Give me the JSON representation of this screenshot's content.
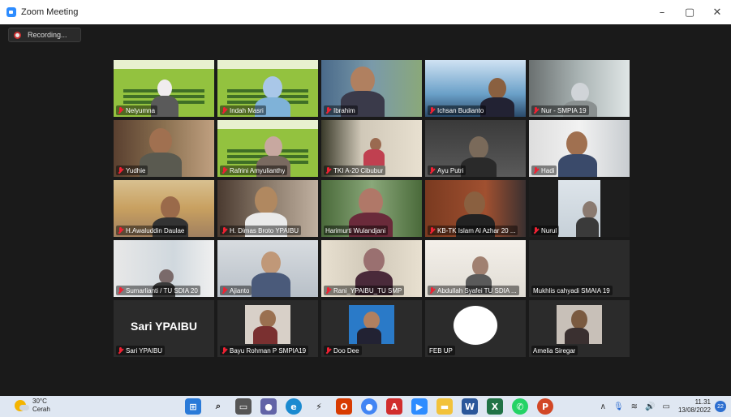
{
  "window": {
    "title": "Zoom Meeting",
    "minimize": "–",
    "restore": "▢",
    "close": "✕"
  },
  "recording": {
    "label": "Recording..."
  },
  "participants": [
    {
      "name": "Nelyumna"
    },
    {
      "name": "Indah Masri"
    },
    {
      "name": "Ibrahim"
    },
    {
      "name": "Ichsan Budianto"
    },
    {
      "name": "Nur - SMPIA 19"
    },
    {
      "name": "Yudhie"
    },
    {
      "name": "Rafrini Amyulianthy"
    },
    {
      "name": "TKI A-20 Cibubur"
    },
    {
      "name": "Ayu Putri"
    },
    {
      "name": "Hadi"
    },
    {
      "name": "H.Awaluddin Daulae"
    },
    {
      "name": "H. Dimas Broto YPAIBU"
    },
    {
      "name": "Harimurti Wulandjani"
    },
    {
      "name": "KB-TK Islam Al Azhar 20 ..."
    },
    {
      "name": "Nurul"
    },
    {
      "name": "Sumarlianti / TU SDIA 20"
    },
    {
      "name": "Ajianto"
    },
    {
      "name": "Rani_YPAIBU_TU SMP"
    },
    {
      "name": "Abdullah Syafei TU SDIA ..."
    },
    {
      "name": "Mukhlis cahyadi SMAIA 19"
    },
    {
      "name": "Sari YPAIBU",
      "display_name": "Sari YPAIBU"
    },
    {
      "name": "Bayu Rohman P SMPIA19"
    },
    {
      "name": "Doo Dee"
    },
    {
      "name": "FEB UP"
    },
    {
      "name": "Amelia Siregar"
    }
  ],
  "taskbar": {
    "weather_temp": "30°C",
    "weather_desc": "Cerah",
    "time": "11.31",
    "date": "13/08/2022",
    "notification_count": "22",
    "apps": [
      "start-menu-icon",
      "search-icon",
      "task-view-icon",
      "teams-chat-icon",
      "edge-icon",
      "app-bolt-icon",
      "office-icon",
      "chrome-icon",
      "acrobat-icon",
      "zoom-icon",
      "file-explorer-icon",
      "word-icon",
      "excel-icon",
      "whatsapp-icon",
      "powerpoint-icon"
    ]
  }
}
